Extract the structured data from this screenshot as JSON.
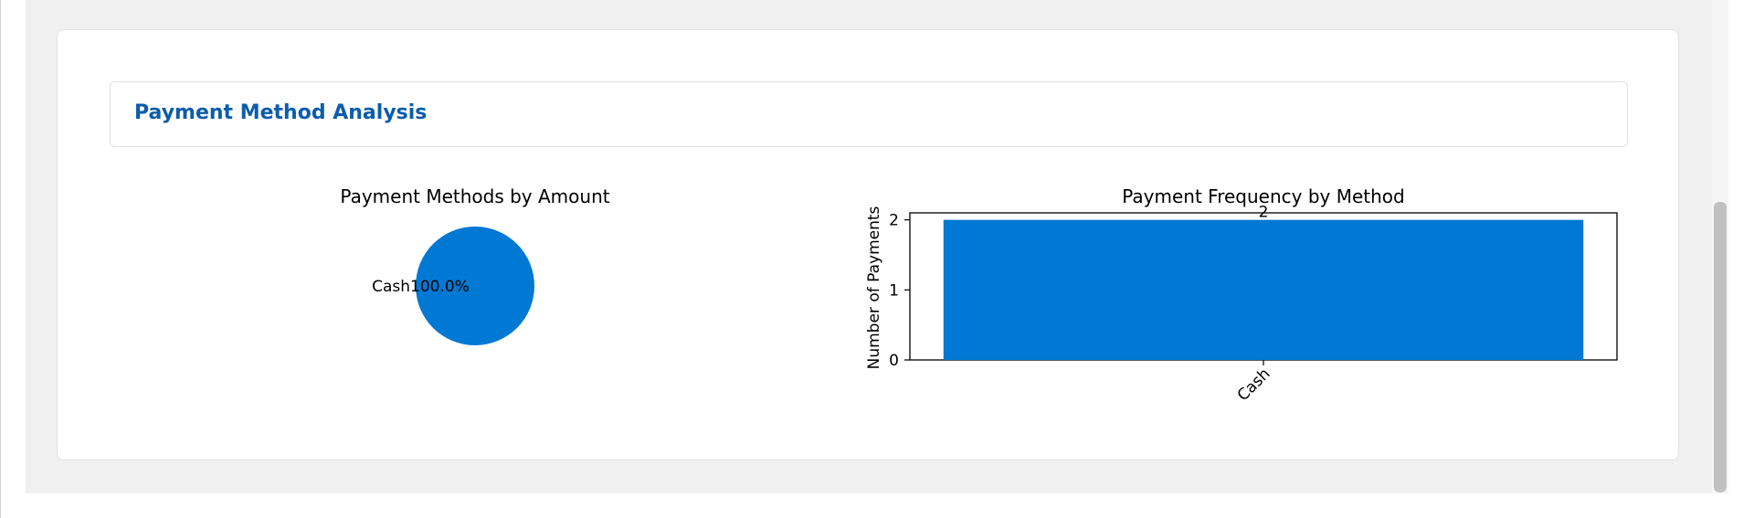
{
  "section": {
    "title": "Payment Method Analysis"
  },
  "chart_data": [
    {
      "type": "pie",
      "title": "Payment Methods by Amount",
      "slices": [
        {
          "label": "Cash",
          "percent": 100.0,
          "value_label": "100.0%",
          "color": "#0078d4"
        }
      ]
    },
    {
      "type": "bar",
      "title": "Payment Frequency by Method",
      "categories": [
        "Cash"
      ],
      "values": [
        2
      ],
      "data_labels": [
        "2"
      ],
      "xlabel": "",
      "ylabel": "Number of Payments",
      "ylim": [
        0,
        2.1
      ],
      "yticks": [
        0,
        1,
        2
      ],
      "color": "#0078d4",
      "grid": false
    }
  ]
}
